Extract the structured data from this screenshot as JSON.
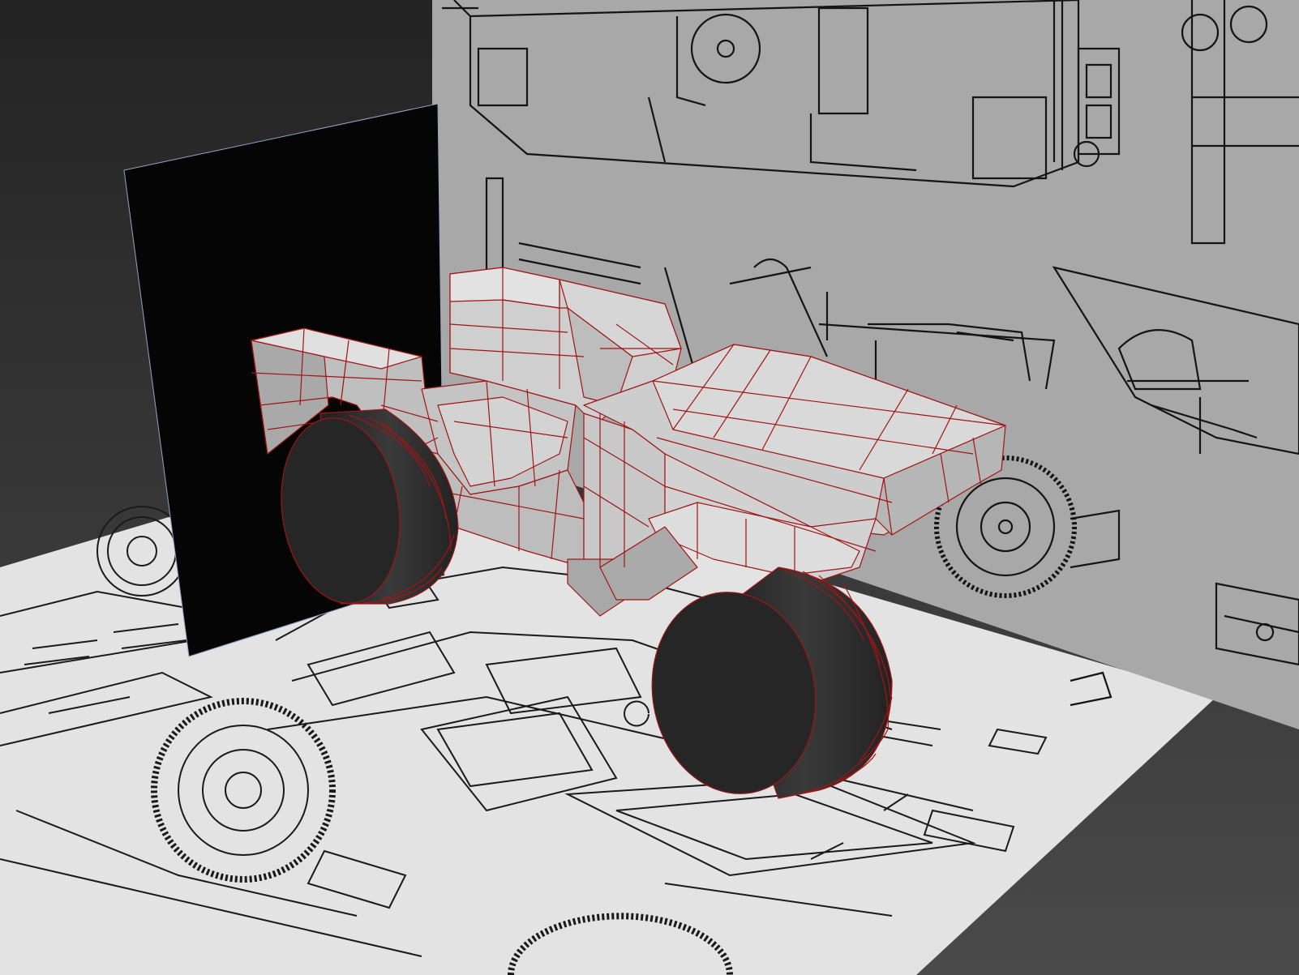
{
  "app": {
    "type": "3d-modeling-viewport"
  },
  "viewport": {
    "background_color": "#2b2b2b",
    "background_gradient_bottom": "#474747",
    "ground_color": "#e2e2e2",
    "back_wall_color": "#a7a7a7",
    "side_plane_color": "#050505",
    "mesh_fill_color": "#cfcfcf",
    "mesh_wire_color": "#a01010",
    "tire_color": "#262626",
    "line_color": "#1a1a1a"
  },
  "scene": {
    "objects": [
      {
        "name": "ground-blueprint-plane",
        "kind": "reference-image-plane"
      },
      {
        "name": "back-blueprint-plane",
        "kind": "reference-image-plane"
      },
      {
        "name": "side-black-plane",
        "kind": "plane"
      },
      {
        "name": "jeep-body-mesh",
        "kind": "editable-poly"
      },
      {
        "name": "front-wheel-mesh",
        "kind": "cylinder"
      },
      {
        "name": "rear-wheel-mesh",
        "kind": "cylinder"
      }
    ]
  }
}
